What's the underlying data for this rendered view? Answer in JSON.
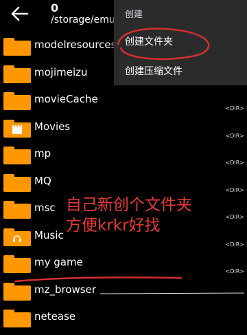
{
  "toolbar": {
    "count": "0",
    "path": "/storage/emu"
  },
  "menu": {
    "title": "创建",
    "items": [
      {
        "label": "创建文件夹"
      },
      {
        "label": "创建压缩文件"
      }
    ]
  },
  "files": [
    {
      "name": "modelresources",
      "type": "<DIR>",
      "icon": "folder-icon"
    },
    {
      "name": "mojimeizu",
      "type": "<DIR>",
      "icon": "folder-icon"
    },
    {
      "name": "movieCache",
      "type": "<DIR>",
      "icon": "folder-icon"
    },
    {
      "name": "Movies",
      "type": "<DIR>",
      "icon": "movie-folder-icon"
    },
    {
      "name": "mp",
      "type": "<DIR>",
      "icon": "folder-icon"
    },
    {
      "name": "MQ",
      "type": "<DIR>",
      "icon": "folder-icon"
    },
    {
      "name": "msc",
      "type": "<DIR>",
      "icon": "folder-icon"
    },
    {
      "name": "Music",
      "type": "<DIR>",
      "icon": "music-folder-icon"
    },
    {
      "name": "my game",
      "type": "<DIR>",
      "icon": "folder-icon"
    },
    {
      "name": "mz_browser",
      "type": "",
      "icon": "folder-icon"
    },
    {
      "name": "netease",
      "type": "",
      "icon": "folder-icon"
    }
  ],
  "annotation": {
    "line1": "自己新创个文件夹",
    "line2": "方便krkr好找"
  },
  "colors": {
    "folder": "#ff9800",
    "annotation": "#e53935",
    "menu_bg": "#2b2b2b"
  }
}
